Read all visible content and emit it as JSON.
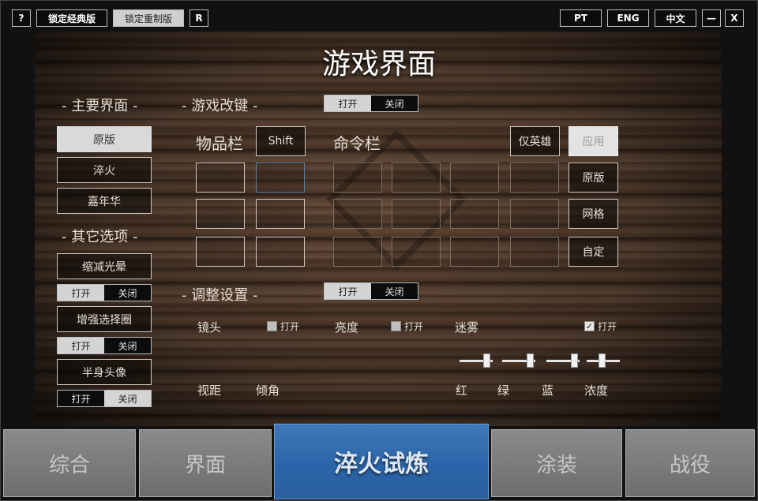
{
  "header": {
    "help": "?",
    "lock_classic": "锁定经典版",
    "lock_remake": "锁定重制版",
    "reset": "R",
    "lang_pt": "PT",
    "lang_eng": "ENG",
    "lang_cn": "中文",
    "minimize": "—",
    "close": "X"
  },
  "title": "游戏界面",
  "left": {
    "main_ui_title": "- 主要界面 -",
    "main_ui_options": [
      "原版",
      "淬火",
      "嘉年华"
    ],
    "other_title": "- 其它选项 -",
    "reduce_glow": "缩减光晕",
    "enhance_ring": "增强选择圈",
    "half_portrait": "半身头像",
    "on": "打开",
    "off": "关闭"
  },
  "remap": {
    "title": "- 游戏改键 -",
    "on": "打开",
    "off": "关闭",
    "inventory": "物品栏",
    "shift": "Shift",
    "command": "命令栏",
    "hero_only": "仅英雄",
    "apply": "应用",
    "preset_default": "原版",
    "preset_grid": "网格",
    "preset_custom": "自定"
  },
  "adjust": {
    "title": "- 调整设置 -",
    "on": "打开",
    "off": "关闭",
    "lens": "镜头",
    "brightness": "亮度",
    "fog": "迷雾",
    "enable": "打开",
    "view_distance": "视距",
    "tilt": "倾角",
    "red": "红",
    "green": "绿",
    "blue": "蓝",
    "density": "浓度",
    "checkmark": "✓",
    "sliders": {
      "red": 0.9,
      "green": 0.95,
      "blue": 0.95,
      "density": 0.45
    }
  },
  "tabs": [
    "综合",
    "界面",
    "淬火试炼",
    "涂装",
    "战役"
  ]
}
